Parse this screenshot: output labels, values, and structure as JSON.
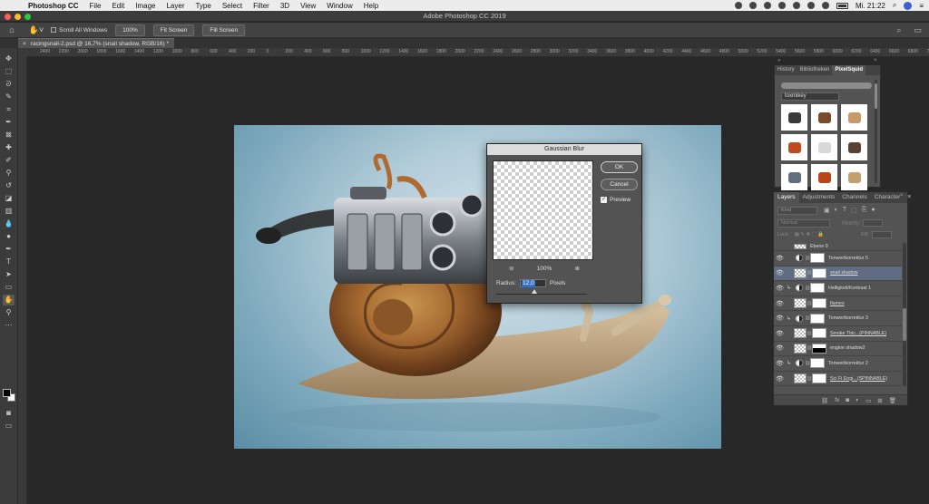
{
  "menubar": {
    "app_name": "Photoshop CC",
    "menus": [
      "File",
      "Edit",
      "Image",
      "Layer",
      "Type",
      "Select",
      "Filter",
      "3D",
      "View",
      "Window",
      "Help"
    ],
    "clock": "Mi. 21:22"
  },
  "window": {
    "title": "Adobe Photoshop CC 2019"
  },
  "options_bar": {
    "scroll_all_windows": "Scroll All Windows",
    "zoom_100": "100%",
    "fit_screen": "Fit Screen",
    "fill_screen": "Fill Screen"
  },
  "document_tab": {
    "close": "×",
    "label": "racingsnail-2.psd @ 16,7% (snail shadow, RGB/16) *"
  },
  "ruler_ticks": [
    "2400",
    "2200",
    "2000",
    "1800",
    "1600",
    "1400",
    "1200",
    "1000",
    "800",
    "600",
    "400",
    "200",
    "0",
    "200",
    "400",
    "600",
    "800",
    "1000",
    "1200",
    "1400",
    "1600",
    "1800",
    "2000",
    "2200",
    "2400",
    "2600",
    "2800",
    "3000",
    "3200",
    "3400",
    "3600",
    "3800",
    "4000",
    "4200",
    "4400",
    "4600",
    "4800",
    "5000",
    "5200",
    "5400",
    "5600",
    "5800",
    "6000",
    "6200",
    "6400",
    "6600",
    "6800",
    "7000"
  ],
  "dialog": {
    "title": "Gaussian Blur",
    "ok": "OK",
    "cancel": "Cancel",
    "preview_label": "Preview",
    "preview_checked": true,
    "zoom": "100%",
    "radius_label": "Radius:",
    "radius_value": "12,0",
    "radius_unit": "Pixels"
  },
  "pixelsquid_panel": {
    "tabs": [
      "History",
      "Bibliotheken",
      "PixelSquid"
    ],
    "active_tab": "PixelSquid",
    "user": "toxmikey",
    "thumb_colors": [
      "#3a3a3a",
      "#7a4a2a",
      "#c89866",
      "#c04a1a",
      "#d8d8d8",
      "#5a4030",
      "#607080",
      "#b84418",
      "#c0a070"
    ]
  },
  "layers_panel": {
    "tabs": [
      "Layers",
      "Adjustments",
      "Channels",
      "Character"
    ],
    "active_tab": "Layers",
    "filter_label": "Kind",
    "blend_mode": "Normal",
    "opacity_label": "Opacity:",
    "lock_label": "Lock:",
    "fill_label": "Fill:",
    "partial_top_row": "Ebene 9",
    "layers": [
      {
        "name": "Tonwertkorrektur 5",
        "type": "adj",
        "clip": false,
        "selected": false,
        "underline": false
      },
      {
        "name": "snail shadow",
        "type": "pixel",
        "clip": false,
        "selected": true,
        "underline": true
      },
      {
        "name": "Helligkeit/Kontrast 1",
        "type": "adj",
        "clip": true,
        "selected": false,
        "underline": false
      },
      {
        "name": "flames",
        "type": "pixel",
        "clip": false,
        "selected": false,
        "underline": true
      },
      {
        "name": "Tonwertkorrektur 3",
        "type": "adj",
        "clip": true,
        "selected": false,
        "underline": false
      },
      {
        "name": "Smoke Thic...(PINNABLE)",
        "type": "smart",
        "clip": false,
        "selected": false,
        "underline": true
      },
      {
        "name": "engine shadow2",
        "type": "pixel-dark",
        "clip": false,
        "selected": false,
        "underline": false
      },
      {
        "name": "Tonwertkorrektur 2",
        "type": "adj",
        "clip": true,
        "selected": false,
        "underline": false
      },
      {
        "name": "Sci Fi Engi...(SPINNABLE)",
        "type": "smart",
        "clip": false,
        "selected": false,
        "underline": true
      }
    ]
  }
}
